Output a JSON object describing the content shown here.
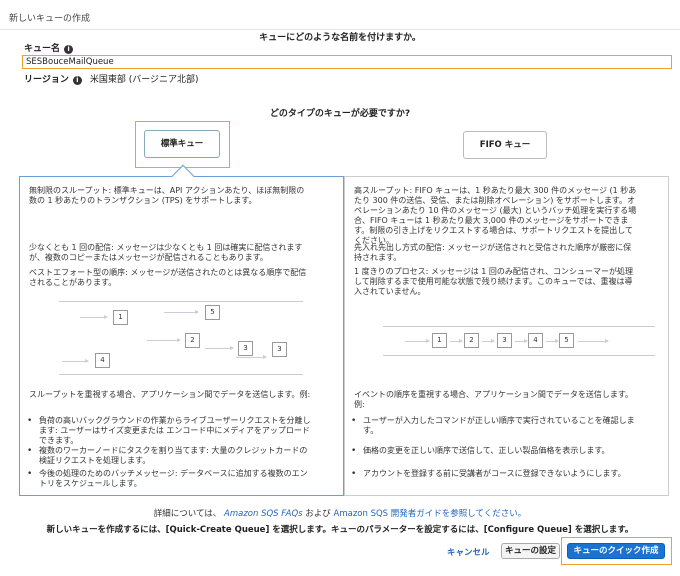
{
  "header": {
    "title": "新しいキューの作成"
  },
  "name_section": {
    "question": "キューにどのような名前を付けますか。",
    "name_label": "キュー名",
    "name_value": "SESBouceMailQueue",
    "region_label": "リージョン",
    "region_value": "米国東部 (バージニア北部)"
  },
  "type_section": {
    "question": "どのタイプのキューが必要ですか?",
    "standard_label": "標準キュー",
    "fifo_label": "FIFO キュー"
  },
  "standard": {
    "p1_l1": "無制限のスループット: 標準キューは、API アクションあたり、ほぼ無制限の",
    "p1_l2": "数の 1 秒あたりのトランザクション (TPS) をサポートします。",
    "p2_l1": "少なくとも 1 回の配信: メッセージは少なくとも 1 回は確実に配信されます",
    "p2_l2": "が、複数のコピーまたはメッセージが配信されることもあります。",
    "p3_l1": "ベストエフォート型の順序: メッセージが送信されたのとは異なる順序で配信",
    "p3_l2": "されることがあります。",
    "diagram_boxes": [
      "1",
      "5",
      "2",
      "4",
      "3",
      "3"
    ],
    "usecase_heading": "スループットを重視する場合、アプリケーション間でデータを送信します。例:",
    "bullet1_l1": "負荷の高いバックグラウンドの作業からライブユーザーリクエストを分離し",
    "bullet1_l2": "ます: ユーザーはサイズ変更または エンコード中にメディアをアップロード",
    "bullet1_l3": "できます。",
    "bullet2_l1": "複数のワーカーノードにタスクを割り当てます: 大量のクレジットカードの",
    "bullet2_l2": "検証リクエストを処理します。",
    "bullet3_l1": "今後の処理のためのバッチメッセージ: データベースに追加する複数のエン",
    "bullet3_l2": "トリをスケジュールします。"
  },
  "fifo": {
    "p1_l1": "高スループット: FIFO キューは、1 秒あたり最大 300 件のメッセージ (1 秒あ",
    "p1_l2": "たり 300 件の送信、受信、または削除オペレーション) をサポートします。オ",
    "p1_l3": "ペレーションあたり 10 件のメッセージ (最大) というバッチ処理を実行する場",
    "p1_l4": "合、FIFO キューは 1 秒あたり最大 3,000 件のメッセージをサポートできま",
    "p1_l5": "す。制限の引き上げをリクエストする場合は、サポートリクエストを提出して",
    "p1_l6": "ください。",
    "p2_l1": "先入れ先出し方式の配信: メッセージが送信されと受信された順序が厳密に保",
    "p2_l2": "持されます。",
    "p3_l1": "1 度きりのプロセス: メッセージは 1 回のみ配信され、コンシューマーが処理",
    "p3_l2": "して削除するまで使用可能な状態で残り続けます。このキューでは、重複は導",
    "p3_l3": "入されていません。",
    "diagram_boxes": [
      "1",
      "2",
      "3",
      "4",
      "5"
    ],
    "usecase_heading_l1": "イベントの順序を重視する場合、アプリケーション間でデータを送信します。",
    "usecase_heading_l2": "例:",
    "bullet1_l1": "ユーザーが入力したコマンドが正しい順序で実行されていることを確認しま",
    "bullet1_l2": "す。",
    "bullet2": "価格の変更を正しい順序で送信して、正しい製品価格を表示します。",
    "bullet3": "アカウントを登録する前に受講者がコースに登録できないようにします。"
  },
  "footer": {
    "info_prefix": "詳細については、",
    "faq_link": "Amazon SQS FAQs",
    "and": "および",
    "guide_link": "Amazon SQS 開発者ガイドを参照してください。",
    "instructions": "新しいキューを作成するには、[Quick-Create Queue] を選択します。キューのパラメーターを設定するには、[Configure Queue] を選択します。",
    "cancel": "キャンセル",
    "configure": "キューの設定",
    "quick_create": "キューのクイック作成"
  },
  "colors": {
    "highlight": "#f0a030",
    "primary": "#1a73d0",
    "link": "#2266bb"
  }
}
